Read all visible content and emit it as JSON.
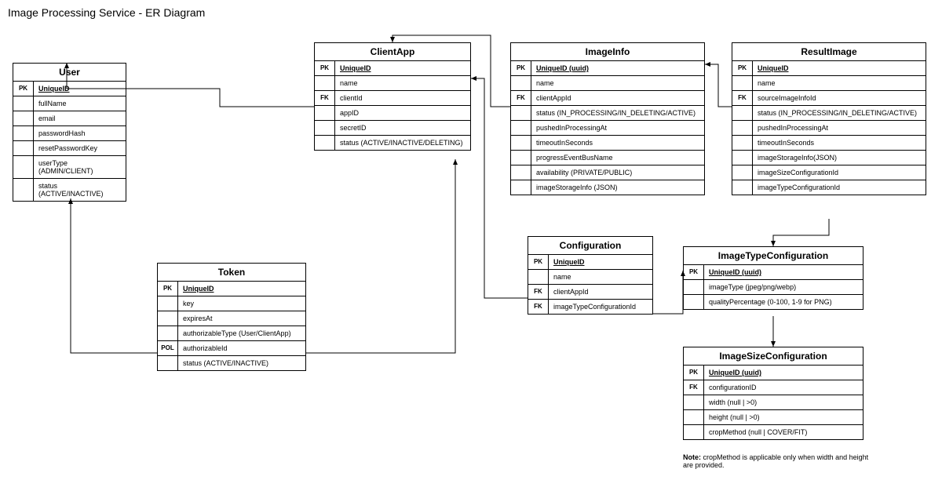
{
  "title": "Image Processing Service - ER Diagram",
  "entities": {
    "user": {
      "name": "User",
      "rows": [
        {
          "key": "PK",
          "attr": "UniqueID",
          "pk": true
        },
        {
          "key": "",
          "attr": "fullName"
        },
        {
          "key": "",
          "attr": "email"
        },
        {
          "key": "",
          "attr": "passwordHash"
        },
        {
          "key": "",
          "attr": "resetPasswordKey"
        },
        {
          "key": "",
          "attr": "userType (ADMIN/CLIENT)"
        },
        {
          "key": "",
          "attr": "status (ACTIVE/INACTIVE)"
        }
      ]
    },
    "clientApp": {
      "name": "ClientApp",
      "rows": [
        {
          "key": "PK",
          "attr": "UniqueID",
          "pk": true
        },
        {
          "key": "",
          "attr": "name"
        },
        {
          "key": "FK",
          "attr": "clientId"
        },
        {
          "key": "",
          "attr": "appID"
        },
        {
          "key": "",
          "attr": "secretID"
        },
        {
          "key": "",
          "attr": "status (ACTIVE/INACTIVE/DELETING)"
        }
      ]
    },
    "imageInfo": {
      "name": "ImageInfo",
      "rows": [
        {
          "key": "PK",
          "attr": "UniqueID (uuid)",
          "pk": true
        },
        {
          "key": "",
          "attr": "name"
        },
        {
          "key": "FK",
          "attr": "clientAppId"
        },
        {
          "key": "",
          "attr": "status (IN_PROCESSING/IN_DELETING/ACTIVE)"
        },
        {
          "key": "",
          "attr": "pushedInProcessingAt"
        },
        {
          "key": "",
          "attr": "timeoutInSeconds"
        },
        {
          "key": "",
          "attr": "progressEventBusName"
        },
        {
          "key": "",
          "attr": "availability (PRIVATE/PUBLIC)"
        },
        {
          "key": "",
          "attr": "imageStorageInfo (JSON)"
        }
      ]
    },
    "resultImage": {
      "name": "ResultImage",
      "rows": [
        {
          "key": "PK",
          "attr": "UniqueID",
          "pk": true
        },
        {
          "key": "",
          "attr": "name"
        },
        {
          "key": "FK",
          "attr": "sourceImageInfoId"
        },
        {
          "key": "",
          "attr": "status (IN_PROCESSING/IN_DELETING/ACTIVE)"
        },
        {
          "key": "",
          "attr": "pushedInProcessingAt"
        },
        {
          "key": "",
          "attr": "timeoutInSeconds"
        },
        {
          "key": "",
          "attr": "imageStorageInfo(JSON)"
        },
        {
          "key": "",
          "attr": "imageSizeConfigurationId"
        },
        {
          "key": "",
          "attr": "imageTypeConfigurationId"
        }
      ]
    },
    "token": {
      "name": "Token",
      "rows": [
        {
          "key": "PK",
          "attr": "UniqueID",
          "pk": true
        },
        {
          "key": "",
          "attr": "key"
        },
        {
          "key": "",
          "attr": "expiresAt"
        },
        {
          "key": "",
          "attr": "authorizableType (User/ClientApp)"
        },
        {
          "key": "POL",
          "attr": "authorizableId"
        },
        {
          "key": "",
          "attr": "status (ACTIVE/INACTIVE)"
        }
      ]
    },
    "configuration": {
      "name": "Configuration",
      "rows": [
        {
          "key": "PK",
          "attr": "UniqueID",
          "pk": true
        },
        {
          "key": "",
          "attr": "name"
        },
        {
          "key": "FK",
          "attr": "clientAppId"
        },
        {
          "key": "FK",
          "attr": "imageTypeConfigurationId"
        }
      ]
    },
    "imageTypeConfiguration": {
      "name": "ImageTypeConfiguration",
      "rows": [
        {
          "key": "PK",
          "attr": "UniqueID (uuid)",
          "pk": true
        },
        {
          "key": "",
          "attr": "imageType (jpeg/png/webp)"
        },
        {
          "key": "",
          "attr": "qualityPercentage (0-100, 1-9 for PNG)"
        }
      ]
    },
    "imageSizeConfiguration": {
      "name": "ImageSizeConfiguration",
      "rows": [
        {
          "key": "PK",
          "attr": "UniqueID (uuid)",
          "pk": true
        },
        {
          "key": "FK",
          "attr": "configurationID"
        },
        {
          "key": "",
          "attr": "width (null | >0)"
        },
        {
          "key": "",
          "attr": "height (null | >0)"
        },
        {
          "key": "",
          "attr": "cropMethod (null | COVER/FIT)"
        }
      ]
    }
  },
  "note": {
    "label": "Note:",
    "text": " cropMethod is applicable only when width and height are provided."
  }
}
